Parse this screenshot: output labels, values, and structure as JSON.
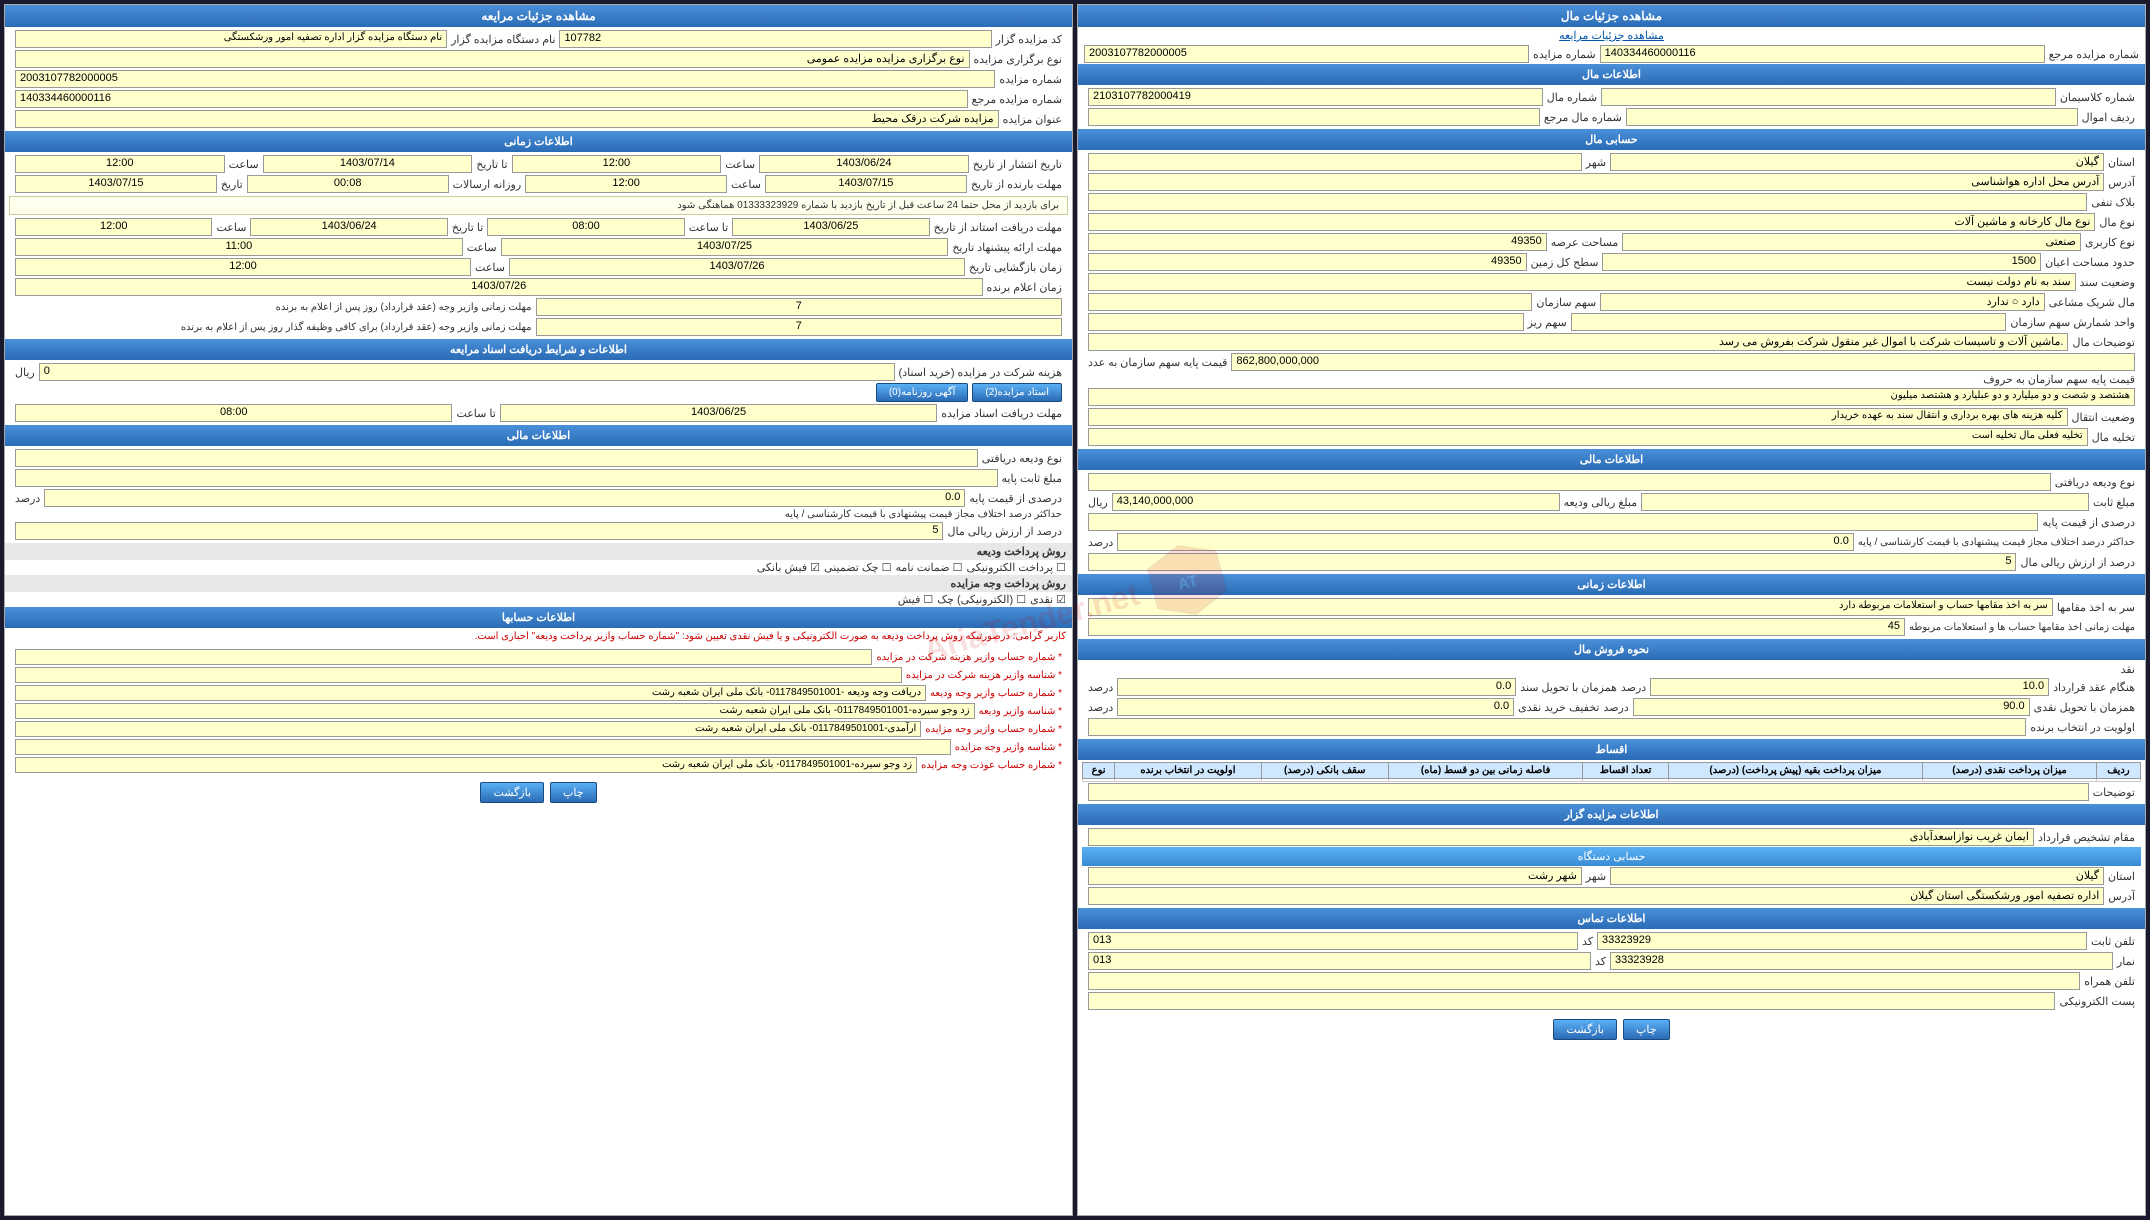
{
  "right_panel": {
    "title": "مشاهده جزئیات مال",
    "breadcrumb": "مشاهده جزئیات مرایعه",
    "fields": {
      "shmara_morajeh_label": "شماره مزایده مرجع",
      "shmara_morajeh_value": "140334460000116",
      "shmara_mozayedeh_label": "شماره مزایده",
      "shmara_mozayedeh_value": "2003107782000005"
    },
    "mal_info_title": "اطلاعات مال",
    "mal_fields": {
      "shmara_mal": "2103107782000419",
      "shomare_kalas": "شماره کلاسیمان",
      "radif_amval": "ردیف اموال",
      "shomare_mal_mrj": "شماره مال مرجع"
    },
    "hesabi_mal_title": "حسابی مال",
    "hesabi_fields": {
      "ostan": "گیلان",
      "shahr": "شهر",
      "adrs": "آدرس محل اداره هواشناسی",
      "blak": "بلاک تنفی ماشین آلات و تاسیسات",
      "nov_mal": "نوع مال کارخانه و ماشین آلات",
      "nov_karabar": "صنعتی",
      "masahat_arza": "49350",
      "masahat_ayan": "حدود مساحت اعیان 1500",
      "sath_kl_zamin": "49350",
      "vaziyat_sanad": "سند به نام دولت نیست",
      "mal_sharik": "دارد ○ ندارد",
      "sahm_sazman": "سهم سازمان",
      "vahed_sharsh": "واحد شمارش سهم سازمان",
      "sahm_riz": "سهم ریز",
      "tozih_mal": "ماشین آلات و تاسیسات شرکت با اموال غیر منقول شرکت بفروش می رسد.",
      "gheimat_paya": "862,800,000,000",
      "gheimat_paya_unit": "ریال",
      "gheimat_paya_label": "قیمت پایه سهم سازمان به عدد",
      "shmara_sanad_label": "قیمت پایه سهم سازمان به حروف",
      "shmara_sanad_value": "هشتصد و شصت و دو میلیارد و دو عبلیارد و هشتصد میلیون",
      "vaziyat_entghal": "کلیه هزینه های بهره برداری و انتقال سند به عهده خریدار",
      "tahliyeh_mal": "تخلیه مال تخلیه فعلی مال تخلیه است"
    },
    "mali_info_title": "اطلاعات مالی",
    "mali_fields": {
      "nov_vadieh": "نوع ودیعه دریافتی",
      "mablag_sabt": "مبلغ ثابت",
      "mablag_vadieh": "43,140,000,000",
      "unit": "ریال",
      "darsad_gheimat_paya": "درصدی از قیمت پایه",
      "haddaksar": "حداکثر درصد اختلاف مجاز قیمت پیشنهادی با قیمت کارشناسی / پایه",
      "haddaksar_value": "0.0",
      "darsad_from_arsh": "5",
      "darsad_from_arsh_label": "درصد از ارزش ریالی مال"
    },
    "zamani_info_title": "اطلاعات زمانی",
    "zamani_fields": {
      "bar_akhd_hesab": "سر به اخذ مقامها حساب و استعلامات مربوطه دارد",
      "mohlat_zamani": "مهلت زمانی اخذ مقامها حساب ها و استعلامات مربوطه",
      "mohlat_value": "45"
    },
    "forush_title": "نحوه فروش مال",
    "forush_fields": {
      "naghd": "نقد",
      "hangam_ghrardar": "10.0",
      "hamzaman_tahvil_sanad": "0.0",
      "hamzaman_naghd": "90.0",
      "taghlil_kharid": "0.0",
      "avlaviyat": "اولویت در انتخاب برنده"
    },
    "aqsat_title": "اقساط",
    "table_headers": [
      "ردیف",
      "میزان پرداخت نقدی (درصد)",
      "میزان پرداخت بقیه (پیش پرداخت) (درصد)",
      "تعداد اقساط",
      "فاصله زمانی بین دو قسط (ماه)",
      "سقف بانکی (درصد)",
      "اولویت در انتخاب برنده",
      "نوع"
    ],
    "mozayedeh_gzar_title": "اطلاعات مزایده گزار",
    "mozayedeh_gzar_fields": {
      "magham": "مقام تشخیص قرارداد",
      "enam_gharib": "ایمان غریب نوازاسعدآبادی",
      "hesabi_title": "حسابی دستگاه",
      "ostan": "گیلان",
      "shahr": "شهر رشت",
      "adrs": "اداره تصفیه امور ورشکستگی استان گیلان"
    },
    "tamas_title": "اطلاعات تماس",
    "tamas_fields": {
      "telf_sabt": "33323929",
      "code_sabt": "013",
      "namar": "33323928",
      "code_namar": "013",
      "telf_hamrah": "تلفن همراه",
      "post_electronic": "پست الکترونیکی"
    },
    "buttons": {
      "chap": "چاپ",
      "bargasht": "بازگشت"
    }
  },
  "left_panel": {
    "title": "مشاهده جزئیات مرایعه",
    "fields": {
      "code_mozayedeh_label": "کد مزایده گزار",
      "code_mozayedeh_value": "107782",
      "name_dastgah": "نام دستگاه مزایده گزار اداره تصفیه امور ورشکستگی",
      "nov_bargrazi": "نوع برگزاری مزایده مزایده عمومی",
      "shmara_mozayedeh": "2003107782000005",
      "shmara_mozayedeh_label": "شماره مزایده",
      "shmara_morajeh": "140334460000116",
      "shmara_morajeh_label": "شماره مزایده مرجع",
      "onvan_mozayedeh": "مزایده شرکت درقک محیط"
    },
    "zamani_title": "اطلاعات زمانی",
    "zamani_fields": {
      "tarikh_enteshar_az": "1403/06/24",
      "saat_enteshar_az": "12:00",
      "tarikh_enteshar_ta": "1403/07/14",
      "saat_enteshar_ta": "12:00",
      "mohlat_barnade_az": "1403/07/15",
      "saat_mohlat_az": "12:00",
      "rozane_ersalat": "00:08",
      "tarikh_rozane": "1403/07/15",
      "tozih_hamahangi": "برای بازدید از محل حتما 24 ساعت قبل از تاریخ بازدید با شماره 01333323929 هماهنگی شود",
      "mohlat_ostan_az_tarikh": "1403/06/25",
      "mohlat_ostan_az_saat": "08:00",
      "mohlat_ostan_ta_tarikh": "1403/06/24",
      "mohlat_ostan_ta_saat": "12:00",
      "mohlat_pishnahadeh": "1403/07/25",
      "zaman_pishnahadeh_saat": "11:00",
      "zaman_barganshasi": "1403/07/26",
      "zaman_barganshasi_saat": "12:00",
      "zaman_elam_brande_label": "زمان اعلام برنده",
      "zaman_elam_brande_value": "1403/07/26",
      "mohlat_amzae_ghrardar": "7",
      "mohlat_amzae_ghrardar_label": "مهلت زمانی وازیر وجه (عقد قرارداد) روز پس از اعلام به برنده",
      "mohlat_vazie_moalagh": "7",
      "mohlat_vazie_moalagh_label": "مهلت زمانی وازیر وجه (عقد قرارداد) برای کافی وظیفه گذار روز پس از اعلام به برنده"
    },
    "asnad_title": "اطلاعات و شرایط دریافت اسناد مرایعه",
    "asnad_fields": {
      "hezineh_sherkat": "هزینه شرکت در مزایده (خرید اسناد)",
      "hezineh_value": "0",
      "unit": "ریال",
      "ostad_mozayedeh": "استاد مزایده(2)",
      "agahi_rozname": "آگهی روزنامه(0)",
      "mohlat_daryaft": "مهلت دریافت اسناد مزایده",
      "mohlat_daryaft_az": "1403/06/25",
      "mohlat_daryaft_saat": "08:00"
    },
    "mali_title": "اطلاعات مالی",
    "mali_fields": {
      "nov_vadieh": "نوع ودیعه دریافتی",
      "mablag_sabt_label": "مبلغ ثابت پایه",
      "darsad_gheimat": "درصدی از قیمت پایه",
      "darsad_value": "0.0",
      "darsad_arsh": "5",
      "haddaksar": "حداکثر درصد اختلاف مجاز قیمت پیشنهادی با قیمت کارشناسی / پایه",
      "darsad_arsh_label": "درصد از ارزش ریالی مال"
    },
    "pardakht_title": "روش پرداخت ودیعه",
    "pardakht_options": [
      "پرداخت الکترونیکی",
      "ضمانت نامه",
      "چک تضمینی",
      "فیش بانکی"
    ],
    "pardakht_voje_title": "روش پرداخت وجه مزایده",
    "pardakht_voje_options": [
      "نقدی",
      "(الکترونیکی) چک",
      "فیش"
    ],
    "hesabha_title": "اطلاعات حسابها",
    "note": "کاربر گرامی: درصورتیکه روش پرداخت ودیعه به صورت الکترونیکی و یا فیش نقدی تعیین شود: \"شماره حساب وازیر پرداخت ودیعه\" احباری است.",
    "accounts": [
      {
        "label": "شماره حساب وازیر هزینه شرکت در مزایده",
        "value": ""
      },
      {
        "label": "شناسه وازیر هزینه شرکت در مزایده",
        "value": ""
      },
      {
        "label": "شماره حساب وازیر وجه ودیعه",
        "value": "دریافت وجه ودیعه -0117849501001- بانک ملی ایران شعبه رشت"
      },
      {
        "label": "شناسه وازیر ودیعه",
        "value": "زد وجو سیبرده-0117849501001- بانک ملی ایران شعبه رشت"
      },
      {
        "label": "شماره حساب وازیر وجه مزایده",
        "value": "ارآمدی-0117849501001- بانک ملی ایران شعبه رشت"
      },
      {
        "label": "شناسه وازیر وجه مزایده",
        "value": ""
      },
      {
        "label": "شماره حساب عوذت وجه مزایده",
        "value": "زد وجو سیرده-0117849501001- بانک ملی ایران شعبه رشت"
      }
    ],
    "buttons": {
      "chap": "چاپ",
      "bargasht": "بازگشت"
    }
  },
  "watermark": {
    "logo": "AriaTender.net"
  }
}
